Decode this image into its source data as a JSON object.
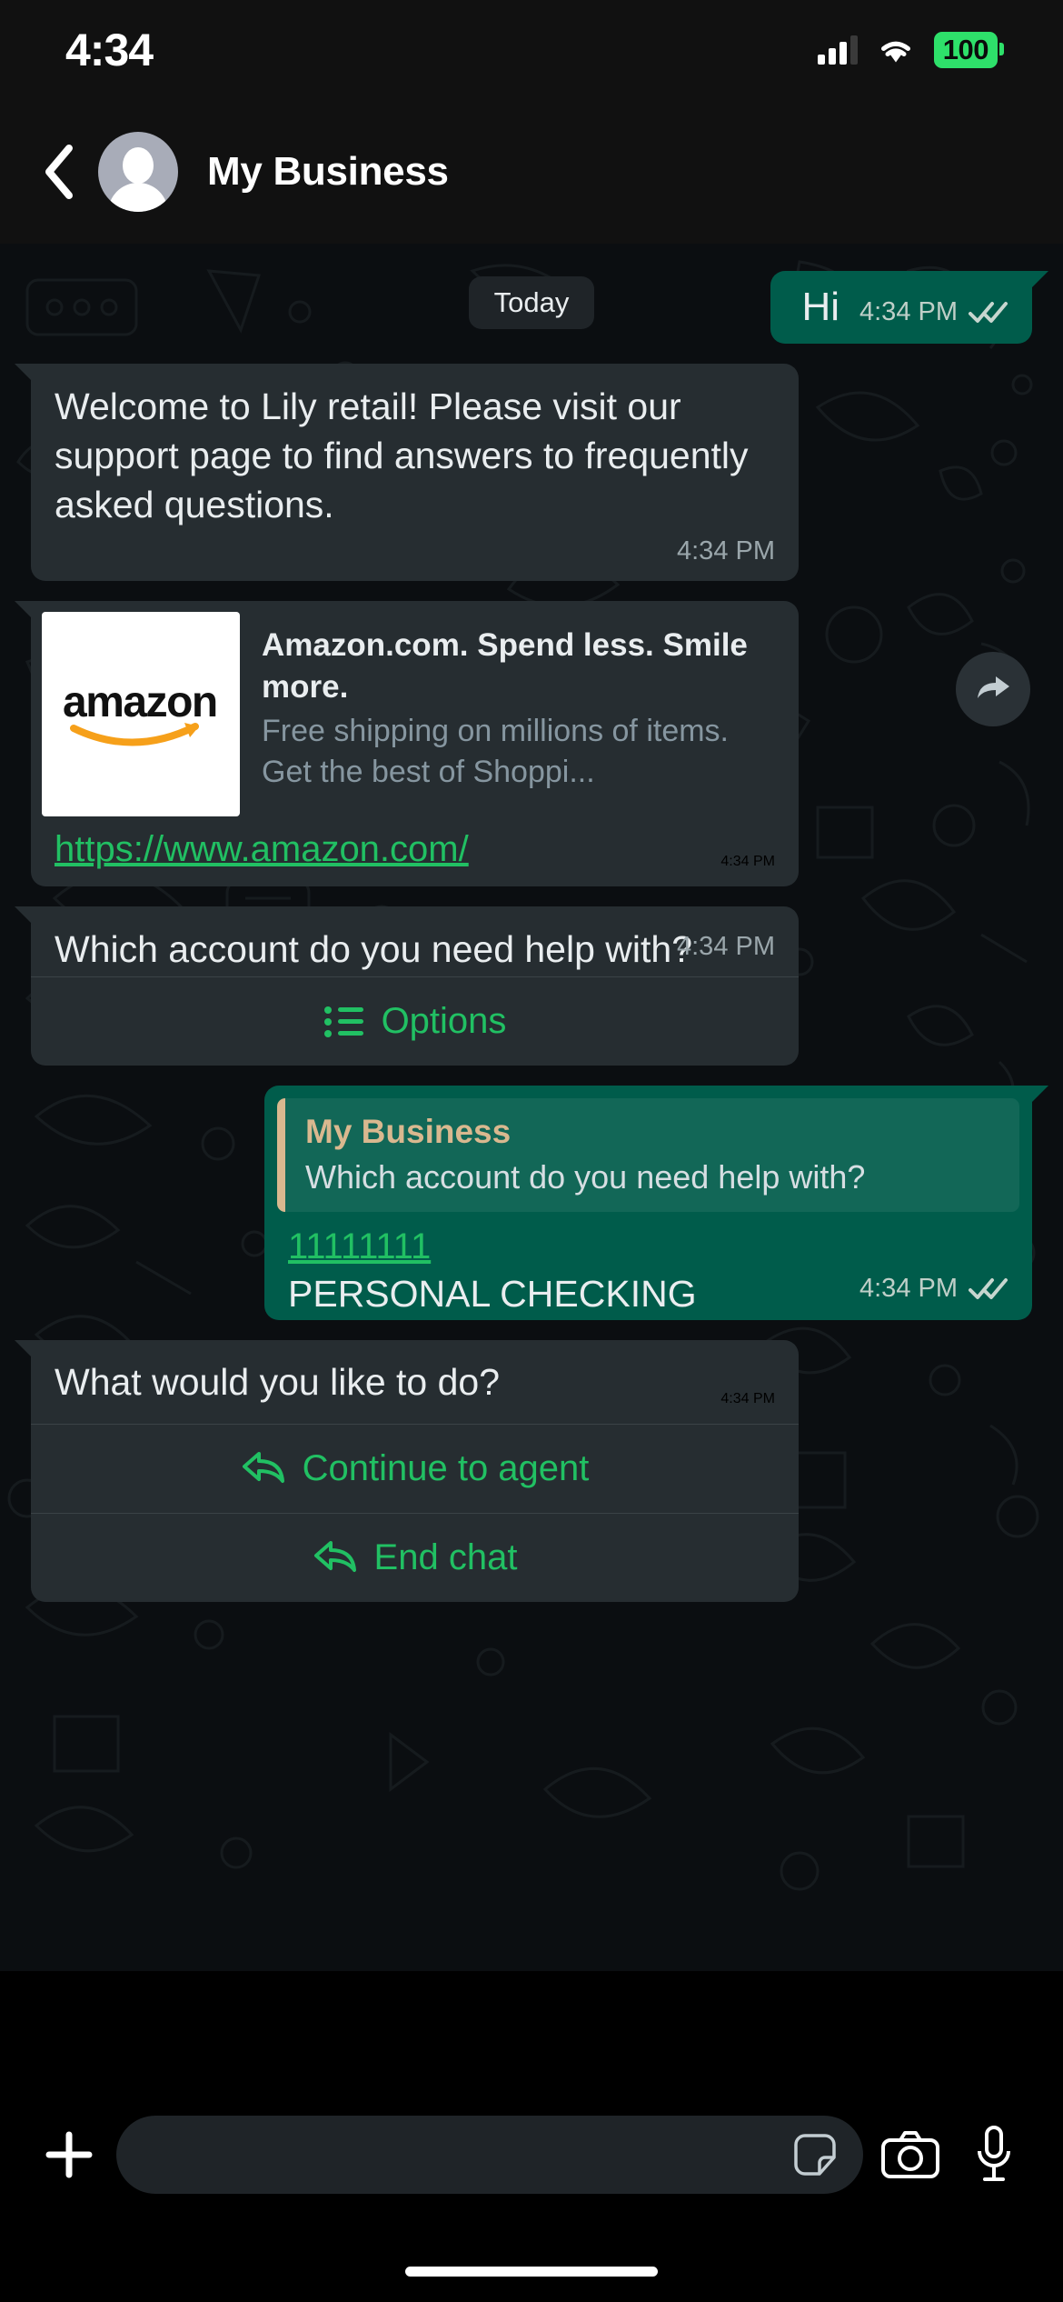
{
  "status_bar": {
    "time": "4:34",
    "battery_level": "100",
    "wifi_icon": "wifi-icon",
    "cellular_icon": "cellular-bars-icon"
  },
  "header": {
    "back_icon": "back-chevron-icon",
    "avatar_icon": "default-avatar-icon",
    "title": "My Business"
  },
  "chat": {
    "date_divider": "Today",
    "accent_green": "#21c063",
    "outgoing_bubble_color": "#005c4b",
    "incoming_bubble_color": "#262d31",
    "quote_accent_color": "#d9b88f",
    "messages": [
      {
        "id": "msg-hi",
        "direction": "outgoing",
        "text": "Hi",
        "time": "4:34 PM",
        "status_icon": "double-check-icon"
      },
      {
        "id": "msg-welcome",
        "direction": "incoming",
        "text": "Welcome to Lily retail! Please visit our support page to find answers to frequently asked questions.",
        "time": "4:34 PM"
      },
      {
        "id": "msg-link-preview",
        "direction": "incoming",
        "preview": {
          "thumbnail_logo": "amazon-logo",
          "thumbnail_alt": "amazon",
          "title": "Amazon.com. Spend less. Smile more.",
          "description": "Free shipping on millions of items. Get the best of Shoppi..."
        },
        "url": "https://www.amazon.com/",
        "time": "4:34 PM",
        "forward_icon": "forward-arrow-icon"
      },
      {
        "id": "msg-which-account",
        "direction": "incoming",
        "text": "Which account do you need help with?",
        "time": "4:34 PM",
        "actions": [
          {
            "label": "Options",
            "icon": "list-icon"
          }
        ]
      },
      {
        "id": "msg-reply-account",
        "direction": "outgoing",
        "quote": {
          "name": "My Business",
          "text": "Which account do you need help with?"
        },
        "account_number": "11111111",
        "account_name": "PERSONAL CHECKING",
        "time": "4:34 PM",
        "status_icon": "double-check-icon"
      },
      {
        "id": "msg-what-to-do",
        "direction": "incoming",
        "text": "What would you like to do?",
        "time": "4:34 PM",
        "actions": [
          {
            "label": "Continue to agent",
            "icon": "reply-arrow-icon"
          },
          {
            "label": "End chat",
            "icon": "reply-arrow-icon"
          }
        ]
      }
    ]
  },
  "input_bar": {
    "plus_icon": "plus-icon",
    "message_placeholder": "",
    "sticker_icon": "sticker-icon",
    "camera_icon": "camera-icon",
    "mic_icon": "microphone-icon"
  }
}
